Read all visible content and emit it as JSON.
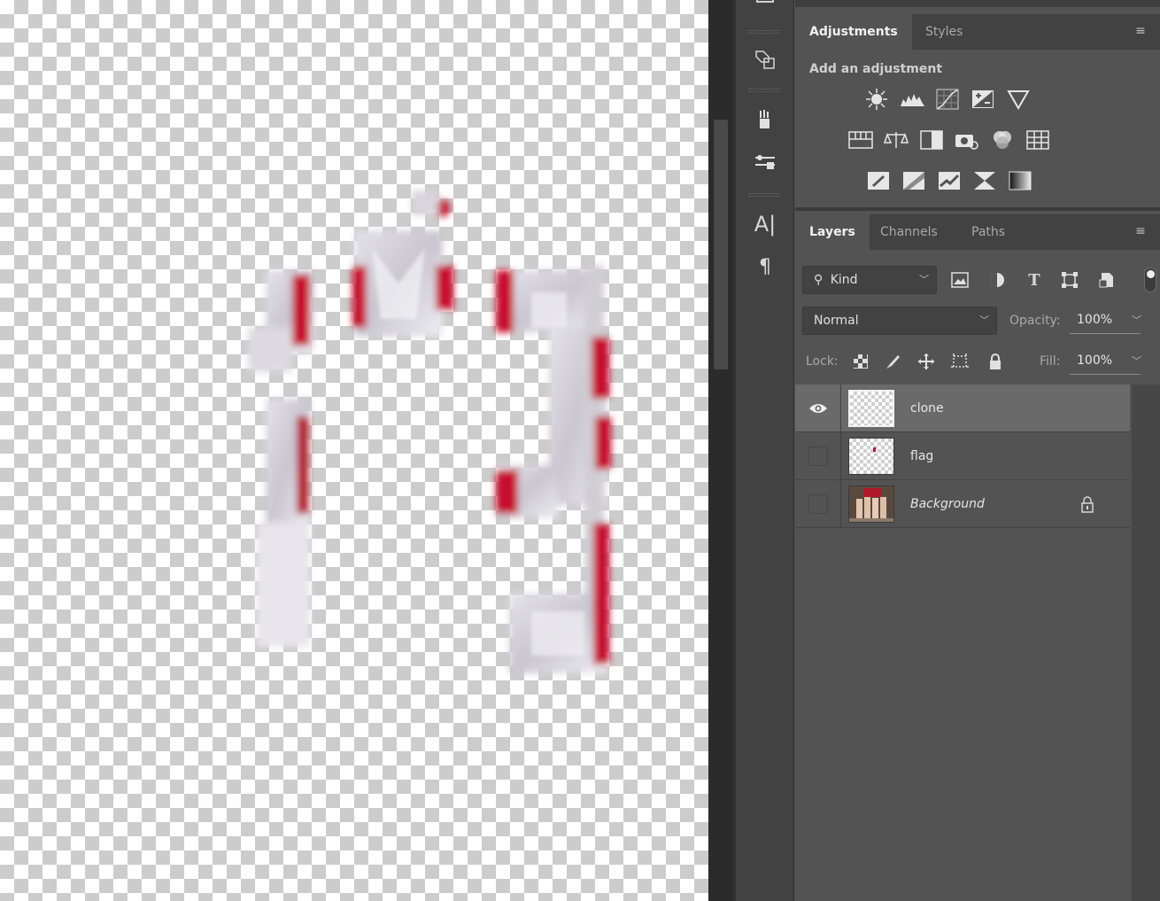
{
  "adjustments_panel": {
    "tabs": [
      {
        "label": "Adjustments"
      },
      {
        "label": "Styles"
      }
    ],
    "title": "Add an adjustment",
    "icons_row1": [
      "brightness-contrast-icon",
      "levels-icon",
      "curves-icon",
      "exposure-icon",
      "vibrance-icon"
    ],
    "icons_row2": [
      "hue-saturation-icon",
      "color-balance-icon",
      "black-white-icon",
      "photo-filter-icon",
      "channel-mixer-icon",
      "color-lookup-icon"
    ],
    "icons_row3": [
      "invert-icon",
      "posterize-icon",
      "threshold-icon",
      "selective-color-icon",
      "gradient-map-icon"
    ]
  },
  "layers_panel": {
    "tabs": [
      {
        "label": "Layers"
      },
      {
        "label": "Channels"
      },
      {
        "label": "Paths"
      }
    ],
    "filter_kind": "Kind",
    "blend_mode": "Normal",
    "opacity_label": "Opacity:",
    "opacity_value": "100%",
    "lock_label": "Lock:",
    "fill_label": "Fill:",
    "fill_value": "100%",
    "layers": [
      {
        "name": "clone",
        "visible": true,
        "selected": true
      },
      {
        "name": "flag",
        "visible": false,
        "selected": false
      },
      {
        "name": "Background",
        "visible": false,
        "selected": false,
        "locked": true
      }
    ]
  },
  "colors": {
    "flag_red": "#c8102e",
    "panel_bg": "#535353",
    "selected_row": "#6a6a6a"
  }
}
